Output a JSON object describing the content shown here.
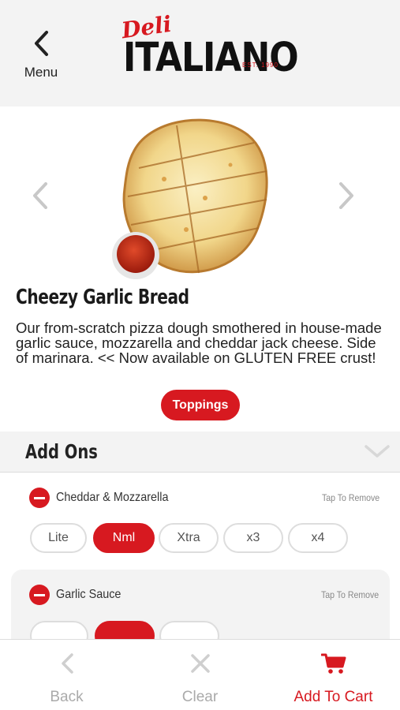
{
  "header": {
    "menu_label": "Menu",
    "logo": {
      "script": "Deli",
      "main": "ITALIANO",
      "est": "EST. 1990"
    }
  },
  "item": {
    "title": "Cheezy Garlic Bread",
    "description": "Our from-scratch pizza dough smothered in house-made garlic sauce, mozzarella and cheddar jack cheese. Side of marinara. << Now available on GLUTEN FREE crust!",
    "toppings_label": "Toppings"
  },
  "addons": {
    "title": "Add Ons",
    "groups": [
      {
        "name": "Cheddar & Mozzarella",
        "action": "Tap To Remove",
        "options": [
          "Lite",
          "Nml",
          "Xtra",
          "x3",
          "x4"
        ],
        "selected": "Nml"
      },
      {
        "name": "Garlic Sauce",
        "action": "Tap To Remove"
      }
    ]
  },
  "nav": {
    "back": "Back",
    "clear": "Clear",
    "add_to_cart": "Add To Cart"
  },
  "colors": {
    "accent": "#d71920",
    "header_bg": "#f3f3f3",
    "muted": "#aaaaaa"
  },
  "icons": [
    "chevron-left-icon",
    "chevron-right-icon",
    "chevron-down-icon",
    "minus-icon",
    "close-icon",
    "cart-icon"
  ]
}
